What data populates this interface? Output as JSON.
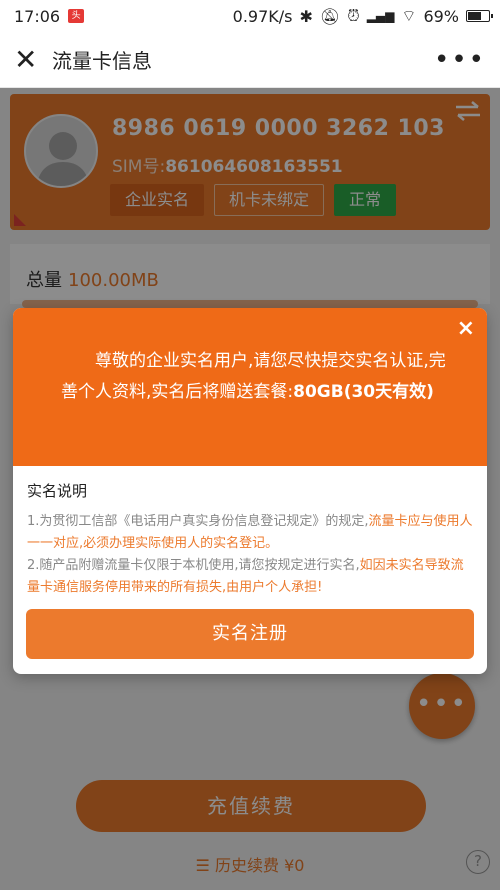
{
  "status_bar": {
    "time": "17:06",
    "notification_icon": "app-badge-icon",
    "speed": "0.97K/s",
    "battery": "69%",
    "battery_level": 0.69
  },
  "nav": {
    "title": "流量卡信息",
    "close_icon": "close-icon",
    "more": "•••"
  },
  "card": {
    "iccid": "8986 0619 0000 3262 103",
    "sim_label": "SIM号:",
    "sim_number": "861064608163551",
    "tags": [
      "企业实名",
      "机卡未绑定",
      "正常"
    ]
  },
  "usage": {
    "label": "总量",
    "value": "100.00MB"
  },
  "modal": {
    "message": "尊敬的企业实名用户,请您尽快提交实名认证,完善个人资料,实名后将赠送套餐:",
    "bonus": "80GB(30天有效)",
    "close": "×",
    "section_title": "实名说明",
    "rule1_text": "1.为贯彻工信部《电话用户真实身份信息登记规定》的规定,",
    "rule1_highlight": "流量卡应与使用人一一对应,必须办理实际使用人的实名登记。",
    "rule2_text": "2.随产品附赠流量卡仅限于本机使用,请您按规定进行实名,",
    "rule2_highlight": "如因未实名导致流量卡通信服务停用带来的所有损失,由用户个人承担!",
    "register_button": "实名注册"
  },
  "bottom": {
    "fab": "•••",
    "recharge_button": "充值续费",
    "history_label": "历史续费",
    "history_amount": "¥0",
    "help": "?"
  },
  "colors": {
    "accent": "#ec7a2d",
    "modal_header": "#ef6a17",
    "status_green": "#2eaa47"
  }
}
